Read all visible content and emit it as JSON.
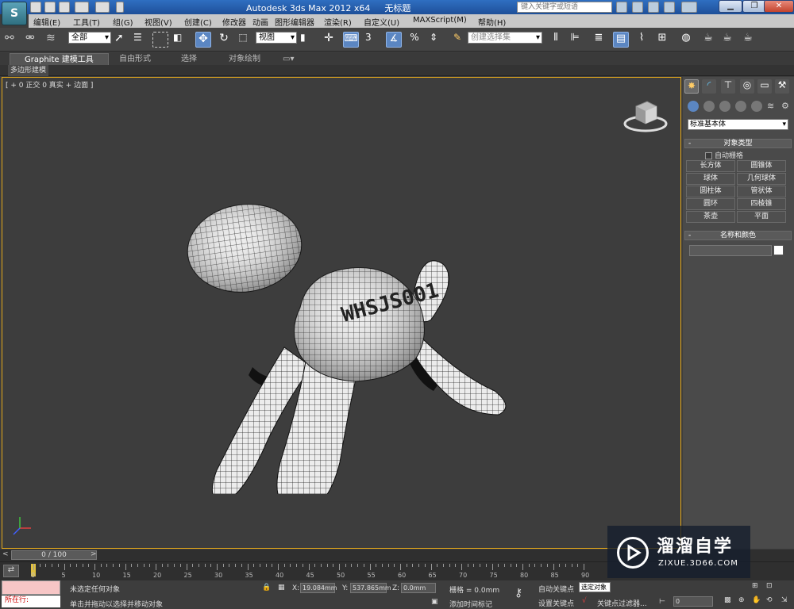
{
  "app": {
    "title": "Autodesk 3ds Max  2012 x64",
    "document": "无标题",
    "logo": "S",
    "search_placeholder": "键入关键字或短语"
  },
  "menu": [
    "编辑(E)",
    "工具(T)",
    "组(G)",
    "视图(V)",
    "创建(C)",
    "修改器",
    "动画",
    "图形编辑器",
    "渲染(R)",
    "自定义(U)",
    "MAXScript(M)",
    "帮助(H)"
  ],
  "toolbar": {
    "selection_filter": "全部",
    "reference_coord": "视图",
    "snap_label": "3",
    "named_selection": "创建选择集"
  },
  "ribbon": {
    "tabs": [
      "Graphite 建模工具",
      "自由形式",
      "选择",
      "对象绘制"
    ],
    "panel": "多边形建模"
  },
  "viewport": {
    "label": "[ + 0 正交 0 真实 + 边面 ]",
    "object_text": "WHSJS001"
  },
  "command_panel": {
    "category": "标准基本体",
    "object_type_title": "对象类型",
    "autogrid": "自动栅格",
    "buttons": [
      "长方体",
      "圆锥体",
      "球体",
      "几何球体",
      "圆柱体",
      "管状体",
      "圆环",
      "四棱锥",
      "茶壶",
      "平面"
    ],
    "name_color_title": "名称和颜色"
  },
  "timeline": {
    "slider": "0 / 100",
    "ticks": [
      "0",
      "5",
      "10",
      "15",
      "20",
      "25",
      "30",
      "35",
      "40",
      "45",
      "50",
      "55",
      "60",
      "65",
      "70",
      "75",
      "80",
      "85",
      "90"
    ]
  },
  "status": {
    "running": "所在行:",
    "selection": "未选定任何对象",
    "prompt": "单击并拖动以选择并移动对象",
    "x_label": "X:",
    "x_value": "19.084mm",
    "y_label": "Y:",
    "y_value": "537.865mm",
    "z_label": "Z:",
    "z_value": "0.0mm",
    "grid": "栅格 = 0.0mm",
    "add_time_tag": "添加时间标记",
    "auto_key": "自动关键点",
    "set_key": "设置关键点",
    "selected_object": "选定对象",
    "key_filters": "关键点过滤器...",
    "frame": "0"
  },
  "watermark": {
    "title": "溜溜自学",
    "url": "ZIXUE.3D66.COM"
  },
  "colors": {
    "accent": "#5b86c2",
    "viewport_border": "#e5a91a",
    "titlebar": "#1e4f99"
  }
}
